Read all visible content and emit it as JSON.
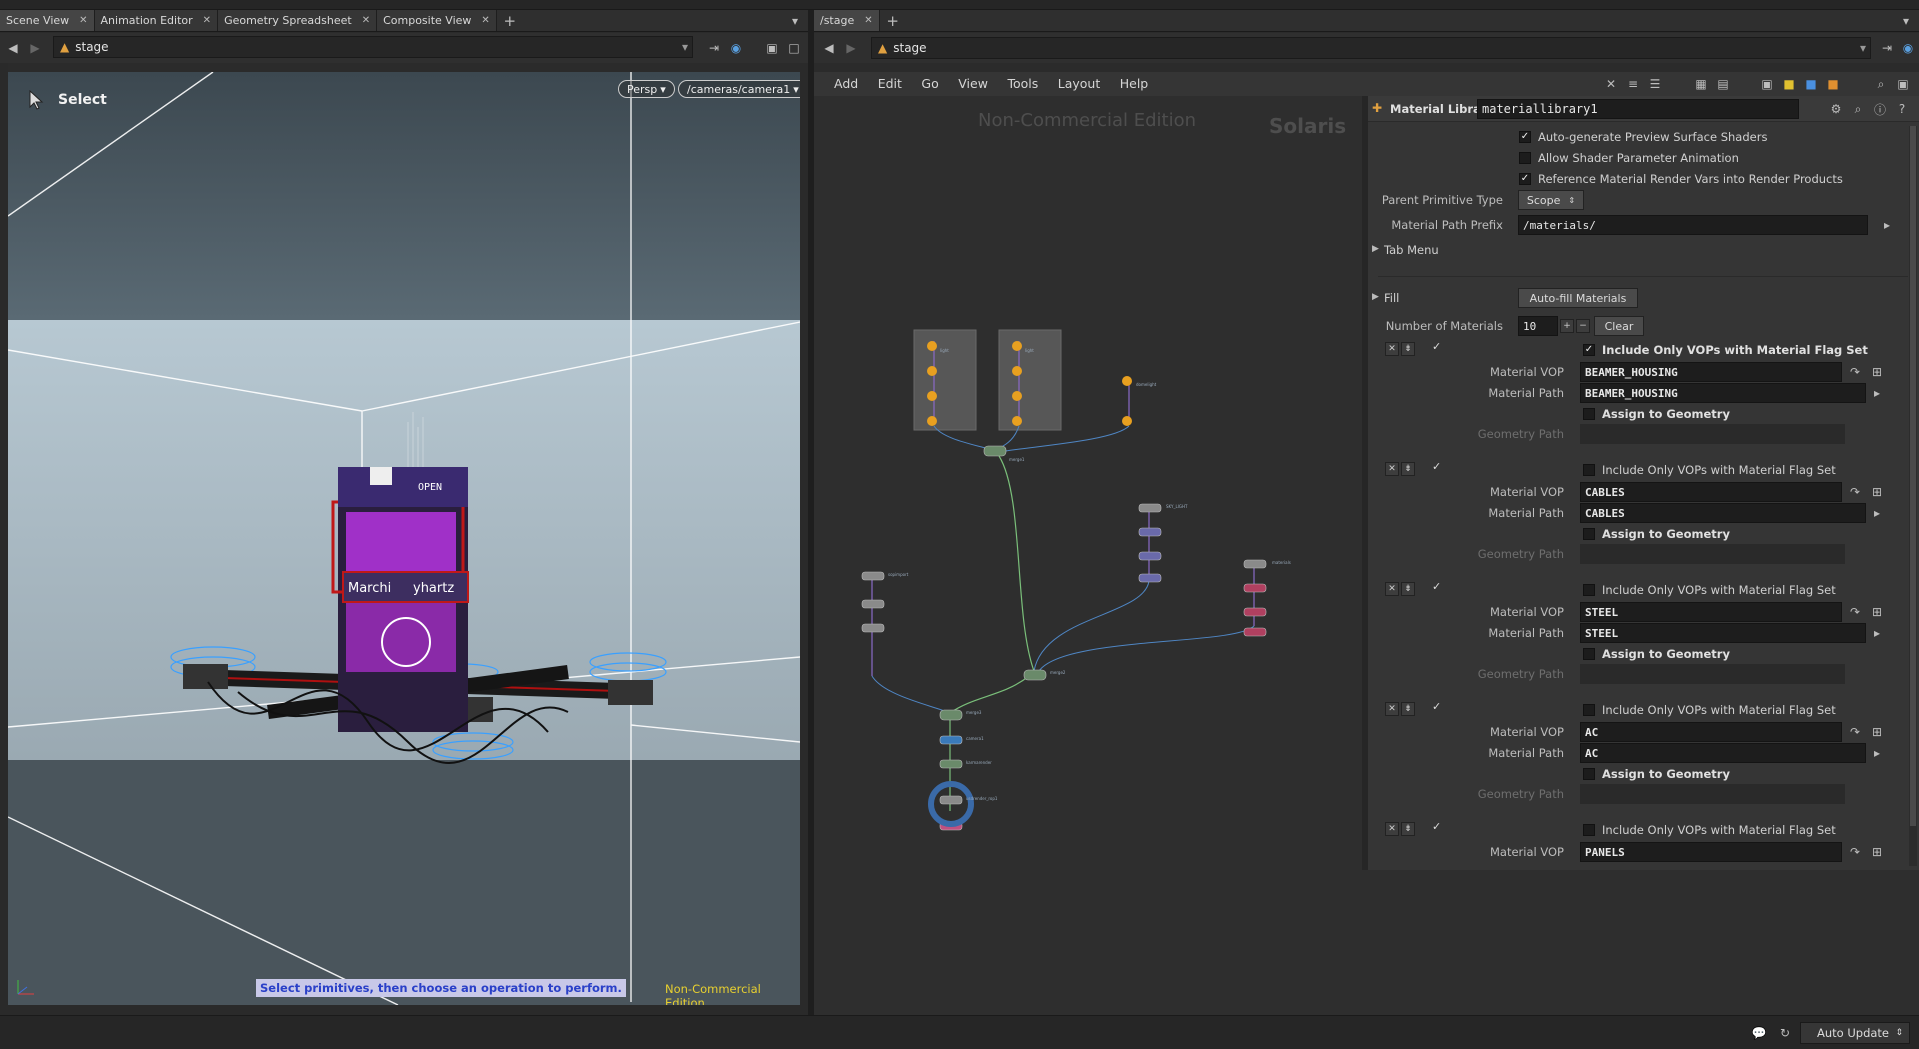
{
  "left_pane": {
    "tabs": [
      {
        "label": "Scene View"
      },
      {
        "label": "Animation Editor"
      },
      {
        "label": "Geometry Spreadsheet"
      },
      {
        "label": "Composite View"
      }
    ],
    "path": "stage",
    "tool_name": "Select",
    "persp_button": "Persp",
    "camera_button": "/cameras/camera1",
    "status_message": "Select primitives, then choose an operation to perform.",
    "watermark": "Non-Commercial Edition",
    "sign_text": [
      "OPEN",
      "Marchi",
      "yhartz"
    ]
  },
  "right_pane": {
    "tab": "/stage",
    "path": "stage",
    "menu": [
      "Add",
      "Edit",
      "Go",
      "View",
      "Tools",
      "Layout",
      "Help"
    ],
    "watermark_left": "Non-Commercial Edition",
    "watermark_right": "Solaris"
  },
  "params": {
    "node_type": "Material Library",
    "node_name": "materiallibrary1",
    "auto_generate": "Auto-generate Preview Surface Shaders",
    "allow_anim": "Allow Shader Parameter Animation",
    "reference_render_vars": "Reference Material Render Vars into Render Products",
    "parent_prim_label": "Parent Primitive Type",
    "parent_prim_value": "Scope",
    "path_prefix_label": "Material Path Prefix",
    "path_prefix_value": "/materials/",
    "tab_menu": "Tab Menu",
    "fill": "Fill",
    "autofill_button": "Auto-fill Materials",
    "num_materials_label": "Number of Materials",
    "num_materials_value": "10",
    "clear_button": "Clear",
    "include_only_label": "Include Only VOPs with Material Flag Set",
    "material_vop_label": "Material VOP",
    "material_path_label": "Material Path",
    "assign_label": "Assign to Geometry",
    "geometry_path_label": "Geometry Path",
    "materials": [
      {
        "vop": "BEAMER_HOUSING",
        "path": "BEAMER_HOUSING"
      },
      {
        "vop": "CABLES",
        "path": "CABLES"
      },
      {
        "vop": "STEEL",
        "path": "STEEL"
      },
      {
        "vop": "AC",
        "path": "AC"
      },
      {
        "vop": "PANELS"
      }
    ]
  },
  "status_bar": {
    "auto_update": "Auto Update"
  }
}
